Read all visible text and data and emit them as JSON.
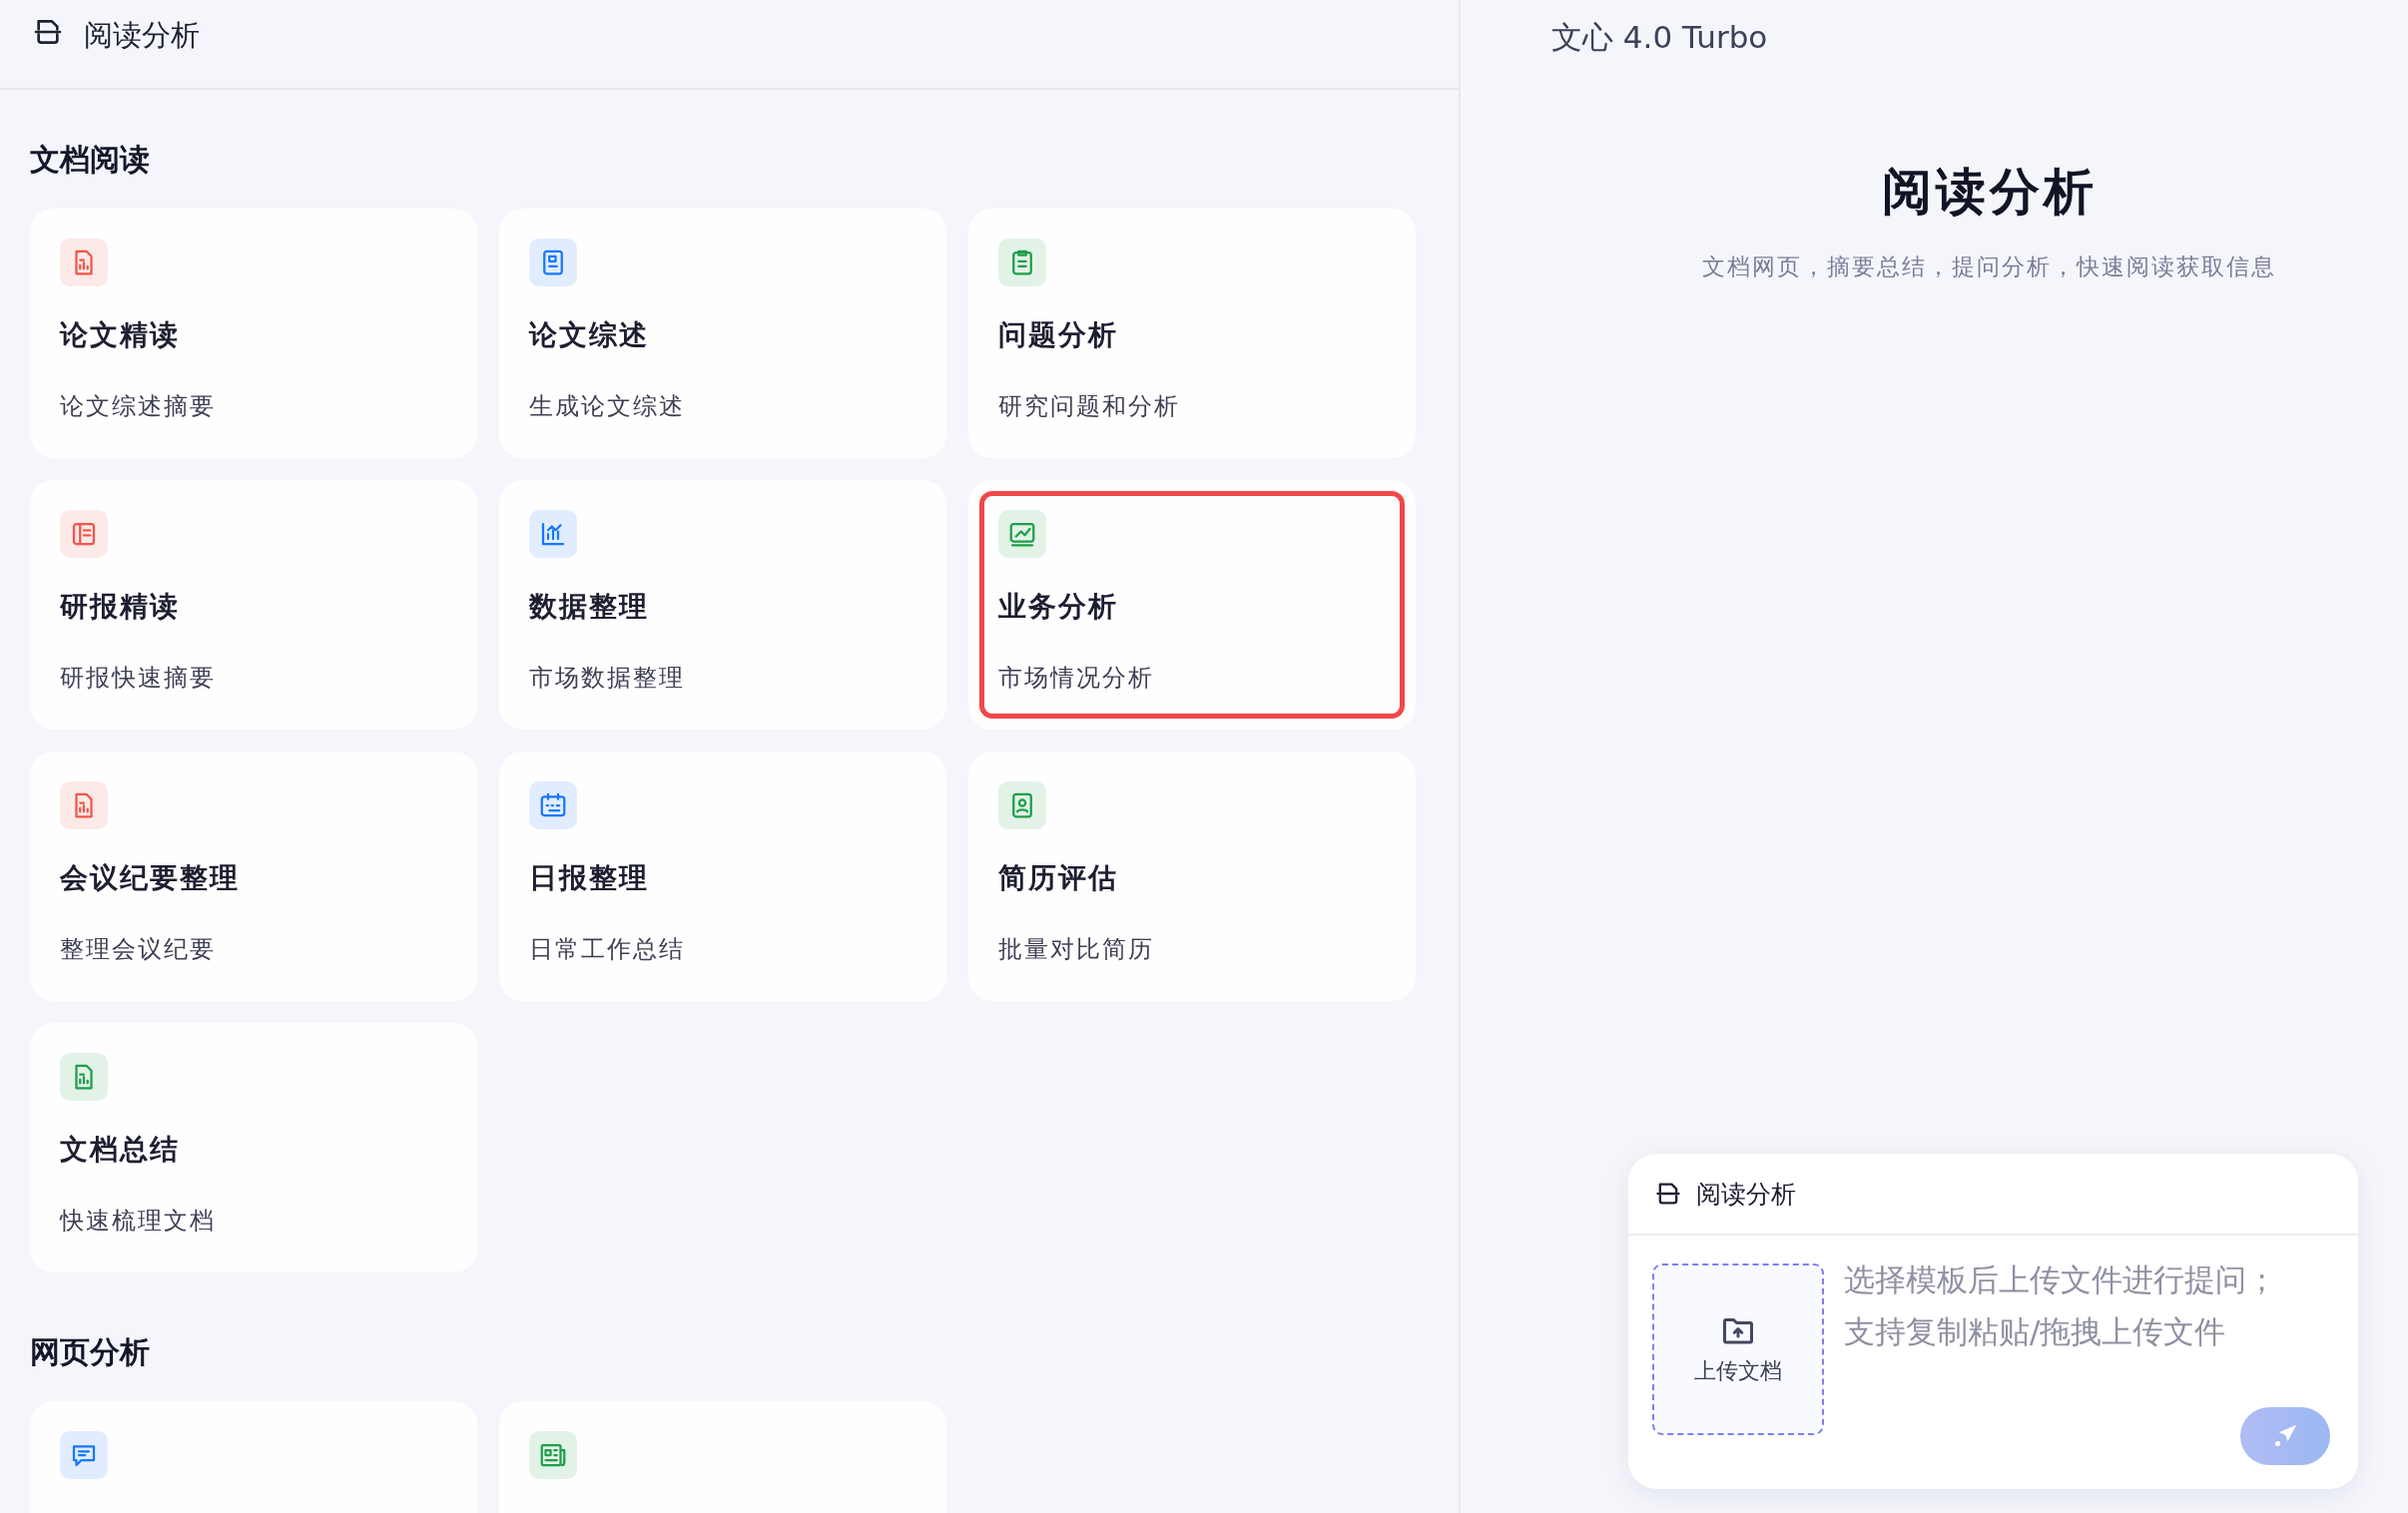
{
  "header": {
    "title": "阅读分析"
  },
  "sections": [
    {
      "title": "文档阅读",
      "cards": [
        {
          "title": "论文精读",
          "description": "论文综述摘要",
          "color": "#f0564a",
          "selected": false
        },
        {
          "title": "论文综述",
          "description": "生成论文综述",
          "color": "#1677ff",
          "selected": false
        },
        {
          "title": "问题分析",
          "description": "研究问题和分析",
          "color": "#1e9e4a",
          "selected": false
        },
        {
          "title": "研报精读",
          "description": "研报快速摘要",
          "color": "#f0564a",
          "selected": false
        },
        {
          "title": "数据整理",
          "description": "市场数据整理",
          "color": "#1677ff",
          "selected": false
        },
        {
          "title": "业务分析",
          "description": "市场情况分析",
          "color": "#1e9e4a",
          "selected": true
        },
        {
          "title": "会议纪要整理",
          "description": "整理会议纪要",
          "color": "#f0564a",
          "selected": false
        },
        {
          "title": "日报整理",
          "description": "日常工作总结",
          "color": "#1677ff",
          "selected": false
        },
        {
          "title": "简历评估",
          "description": "批量对比简历",
          "color": "#1e9e4a",
          "selected": false
        },
        {
          "title": "文档总结",
          "description": "快速梳理文档",
          "color": "#1e9e4a",
          "selected": false
        }
      ]
    },
    {
      "title": "网页分析",
      "cards": [
        {
          "color": "#1677ff",
          "selected": false
        },
        {
          "color": "#1e9e4a",
          "selected": false
        }
      ]
    }
  ],
  "model": {
    "name": "文心 4.0 Turbo"
  },
  "intro": {
    "title": "阅读分析",
    "subtitle": "文档网页，摘要总结，提问分析，快速阅读获取信息"
  },
  "composer": {
    "template": "阅读分析",
    "upload_label": "上传文档",
    "placeholder": "选择模板后上传文件进行提问；支持复制粘贴/拖拽上传文件"
  }
}
